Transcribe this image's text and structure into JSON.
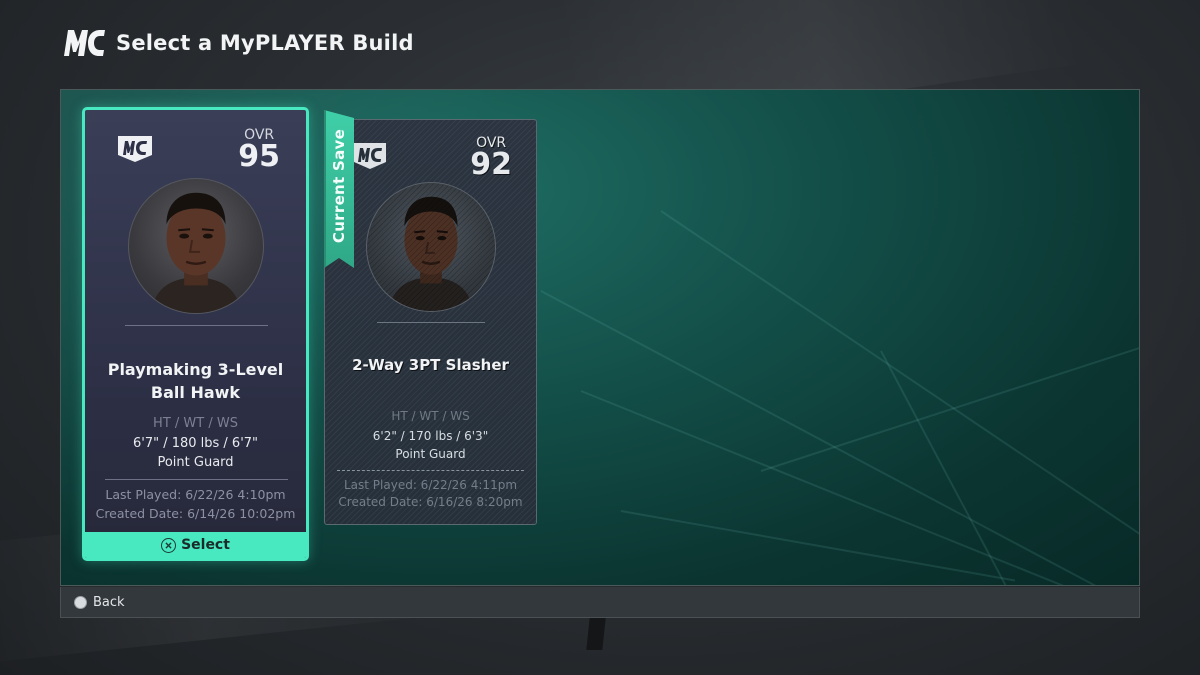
{
  "header": {
    "logo_icon": "mc-logo-icon",
    "title": "Select a MyPLAYER Build"
  },
  "colors": {
    "accent": "#48e8c0",
    "panel": "#134e48",
    "card": "#2d3046"
  },
  "builds": [
    {
      "ovr_label": "OVR",
      "ovr": "95",
      "name_line1": "Playmaking 3-Level",
      "name_line2": "Ball Hawk",
      "attr_label": "HT / WT / WS",
      "attrs": "6'7\" / 180 lbs / 6'7\"",
      "position": "Point Guard",
      "last_played": "Last Played: 6/22/26 4:10pm",
      "created": "Created Date: 6/14/26 10:02pm",
      "action_label": "Select",
      "selected": true
    },
    {
      "ovr_label": "OVR",
      "ovr": "92",
      "name": "2-Way 3PT Slasher",
      "attr_label": "HT / WT / WS",
      "attrs": "6'2\" / 170 lbs / 6'3\"",
      "position": "Point Guard",
      "last_played": "Last Played: 6/22/26 4:11pm",
      "created": "Created Date: 6/16/26 8:20pm",
      "ribbon": "Current Save",
      "selected": false
    }
  ],
  "footer": {
    "back_label": "Back",
    "back_icon": "circle-button-icon"
  }
}
